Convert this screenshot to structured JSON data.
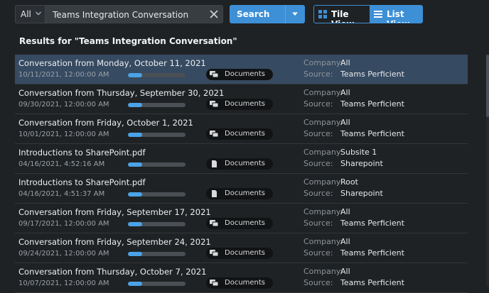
{
  "toolbar": {
    "scope_value": "All",
    "search_value": "Teams Integration Conversation",
    "search_label": "Search",
    "tile_view_label": "Tile View",
    "list_view_label": "List View",
    "active_view": "list",
    "accent_color": "#3d8fd6"
  },
  "results": {
    "heading": "Results for \"Teams Integration Conversation\"",
    "company_label": "Company:",
    "source_label": "Source:",
    "items": [
      {
        "title": "Conversation from Monday, October 11, 2021",
        "date": "10/11/2021, 12:00:00 AM",
        "progress": 0.25,
        "type_label": "Documents",
        "type_icon": "chat-icon",
        "company": "All",
        "source": "Teams Perficient",
        "selected": true
      },
      {
        "title": "Conversation from Thursday, September 30, 2021",
        "date": "09/30/2021, 12:00:00 AM",
        "progress": 0.25,
        "type_label": "Documents",
        "type_icon": "chat-icon",
        "company": "All",
        "source": "Teams Perficient",
        "selected": false
      },
      {
        "title": "Conversation from Friday, October 1, 2021",
        "date": "10/01/2021, 12:00:00 AM",
        "progress": 0.25,
        "type_label": "Documents",
        "type_icon": "chat-icon",
        "company": "All",
        "source": "Teams Perficient",
        "selected": false
      },
      {
        "title": "Introductions to SharePoint.pdf",
        "date": "04/16/2021, 4:52:16 AM",
        "progress": 0.25,
        "type_label": "Documents",
        "type_icon": "document-icon",
        "company": "Subsite 1",
        "source": "Sharepoint",
        "selected": false
      },
      {
        "title": "Introductions to SharePoint.pdf",
        "date": "04/16/2021, 4:51:37 AM",
        "progress": 0.25,
        "type_label": "Documents",
        "type_icon": "document-icon",
        "company": "Root",
        "source": "Sharepoint",
        "selected": false
      },
      {
        "title": "Conversation from Friday, September 17, 2021",
        "date": "09/17/2021, 12:00:00 AM",
        "progress": 0.25,
        "type_label": "Documents",
        "type_icon": "chat-icon",
        "company": "All",
        "source": "Teams Perficient",
        "selected": false
      },
      {
        "title": "Conversation from Friday, September 24, 2021",
        "date": "09/24/2021, 12:00:00 AM",
        "progress": 0.25,
        "type_label": "Documents",
        "type_icon": "chat-icon",
        "company": "All",
        "source": "Teams Perficient",
        "selected": false
      },
      {
        "title": "Conversation from Thursday, October 7, 2021",
        "date": "10/07/2021, 12:00:00 AM",
        "progress": 0.25,
        "type_label": "Documents",
        "type_icon": "chat-icon",
        "company": "All",
        "source": "Teams Perficient",
        "selected": false
      }
    ]
  }
}
